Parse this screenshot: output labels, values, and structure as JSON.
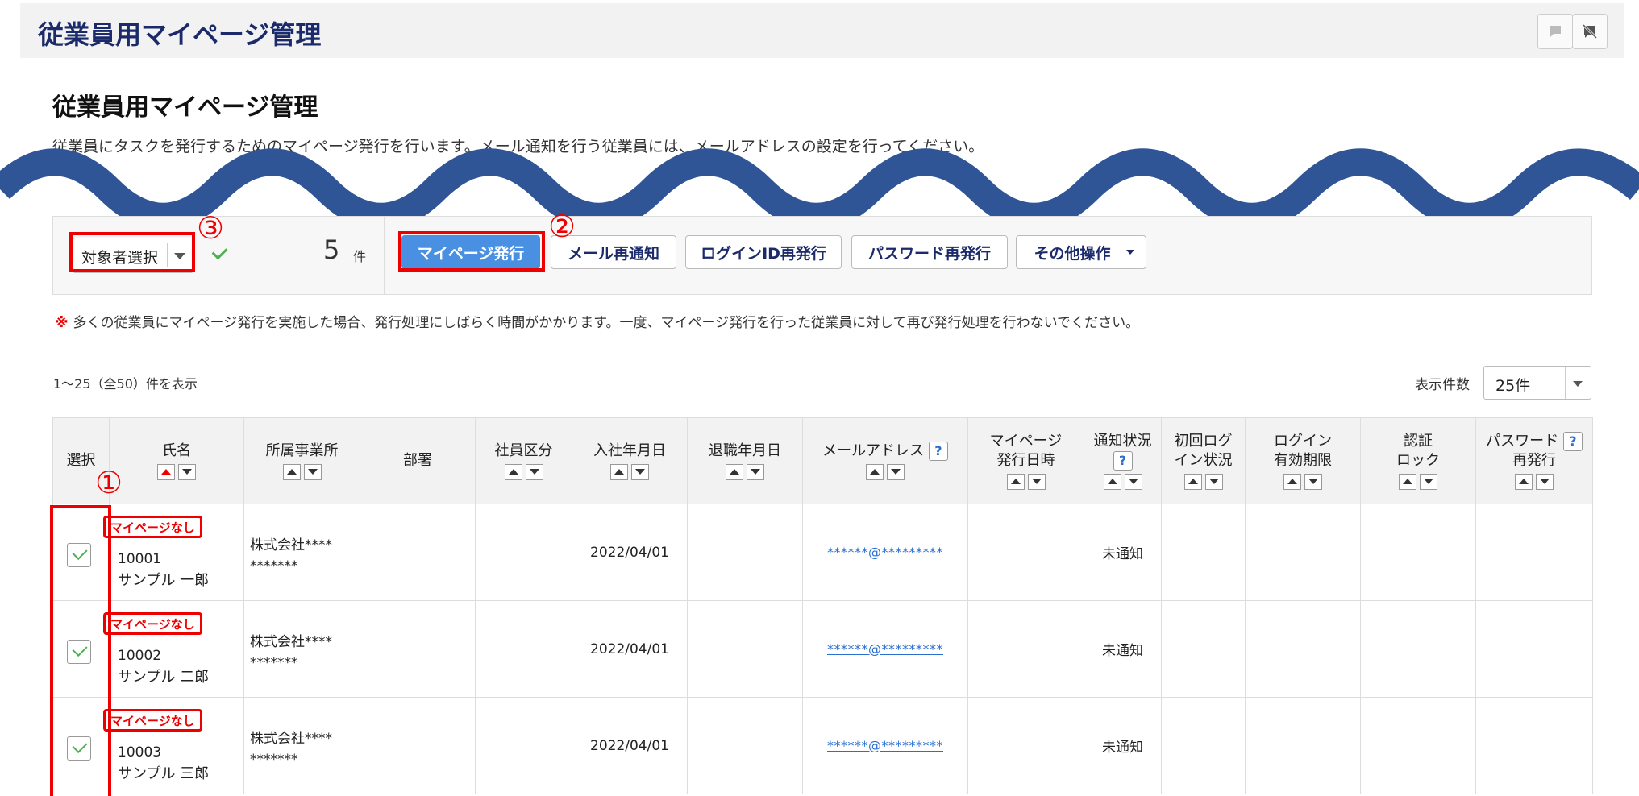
{
  "header": {
    "title": "従業員用マイページ管理",
    "icons": [
      "comment-icon",
      "comment-off-icon"
    ]
  },
  "page": {
    "title": "従業員用マイページ管理",
    "description": "従業員にタスクを発行するためのマイページ発行を行います。メール通知を行う従業員には、メールアドレスの設定を行ってください。"
  },
  "toolbar": {
    "target_select": "対象者選択",
    "count": "5",
    "count_unit": "件",
    "buttons": {
      "issue": "マイページ発行",
      "resend_mail": "メール再通知",
      "reissue_login": "ログインID再発行",
      "reissue_password": "パスワード再発行",
      "other": "その他操作"
    }
  },
  "annotations": {
    "one": "①",
    "two": "②",
    "three": "③"
  },
  "note": {
    "mark": "※",
    "text": "多くの従業員にマイページ発行を実施した場合、発行処理にしばらく時間がかかります。一度、マイページ発行を行った従業員に対して再び発行処理を行わないでください。"
  },
  "list": {
    "range": "1～25（全50）件を表示",
    "per_page_label": "表示件数",
    "per_page_value": "25件"
  },
  "table": {
    "headers": {
      "select": "選択",
      "name": "氏名",
      "office": "所属事業所",
      "dept": "部署",
      "type": "社員区分",
      "join": "入社年月日",
      "leave": "退職年月日",
      "email": "メールアドレス",
      "issued_1": "マイページ",
      "issued_2": "発行日時",
      "notify": "通知状況",
      "first_login_1": "初回ログ",
      "first_login_2": "イン状況",
      "login_exp_1": "ログイン",
      "login_exp_2": "有効期限",
      "auth_1": "認証",
      "auth_2": "ロック",
      "pw_1": "パスワード",
      "pw_2": "再発行"
    },
    "rows": [
      {
        "tag": "マイページなし",
        "id": "10001",
        "name": "サンプル 一郎",
        "office_1": "株式会社****",
        "office_2": "*******",
        "join": "2022/04/01",
        "email": "******@*********",
        "notify": "未通知",
        "checked": true
      },
      {
        "tag": "マイページなし",
        "id": "10002",
        "name": "サンプル 二郎",
        "office_1": "株式会社****",
        "office_2": "*******",
        "join": "2022/04/01",
        "email": "******@*********",
        "notify": "未通知",
        "checked": true
      },
      {
        "tag": "マイページなし",
        "id": "10003",
        "name": "サンプル 三郎",
        "office_1": "株式会社****",
        "office_2": "*******",
        "join": "2022/04/01",
        "email": "******@*********",
        "notify": "未通知",
        "checked": true
      }
    ]
  },
  "colors": {
    "header_title": "#1b2a6b",
    "primary_button": "#4a90e2",
    "annotation_red": "#e00000",
    "wave_blue": "#2f5597",
    "link": "#2a6fd0"
  }
}
